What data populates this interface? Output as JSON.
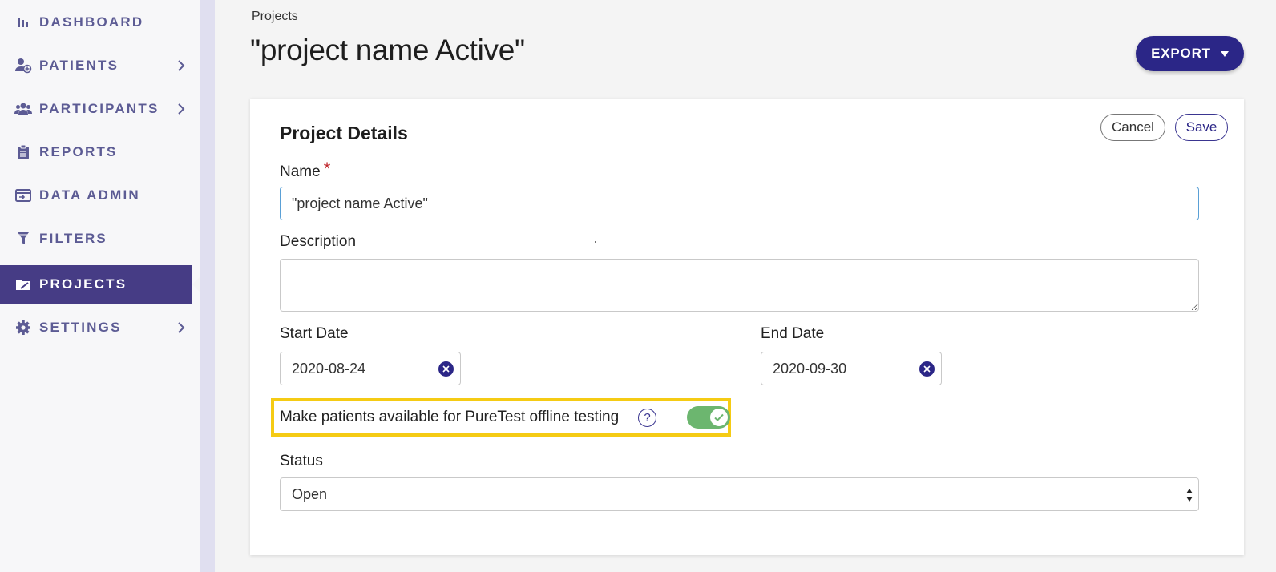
{
  "sidebar": {
    "items": [
      {
        "label": "DASHBOARD",
        "icon": "bar-chart-icon"
      },
      {
        "label": "PATIENTS",
        "icon": "add-user-icon"
      },
      {
        "label": "PARTICIPANTS",
        "icon": "users-icon"
      },
      {
        "label": "REPORTS",
        "icon": "clipboard-icon"
      },
      {
        "label": "DATA ADMIN",
        "icon": "data-admin-icon"
      },
      {
        "label": "FILTERS",
        "icon": "filter-icon"
      },
      {
        "label": "PROJECTS",
        "icon": "projects-icon",
        "active": true
      },
      {
        "label": "SETTINGS",
        "icon": "gear-icon"
      }
    ]
  },
  "header": {
    "breadcrumb": "Projects",
    "title": "\"project name Active\"",
    "export_label": "EXPORT"
  },
  "card": {
    "title": "Project Details",
    "cancel_label": "Cancel",
    "save_label": "Save",
    "name_label": "Name",
    "name_required_mark": "*",
    "name_value": "\"project name Active\"",
    "description_label": "Description",
    "description_value": "",
    "start_date_label": "Start Date",
    "start_date_value": "2020-08-24",
    "end_date_label": "End Date",
    "end_date_value": "2020-09-30",
    "offline_toggle_label": "Make patients available for PureTest offline testing",
    "offline_toggle_on": true,
    "help_symbol": "?",
    "status_label": "Status",
    "status_value": "Open"
  },
  "colors": {
    "accent": "#2b2687",
    "sidebar_active": "#463c85",
    "nav_text": "#5c5b94",
    "toggle_on": "#6cb66f",
    "highlight": "#f5cb14",
    "required": "#c0272d"
  }
}
